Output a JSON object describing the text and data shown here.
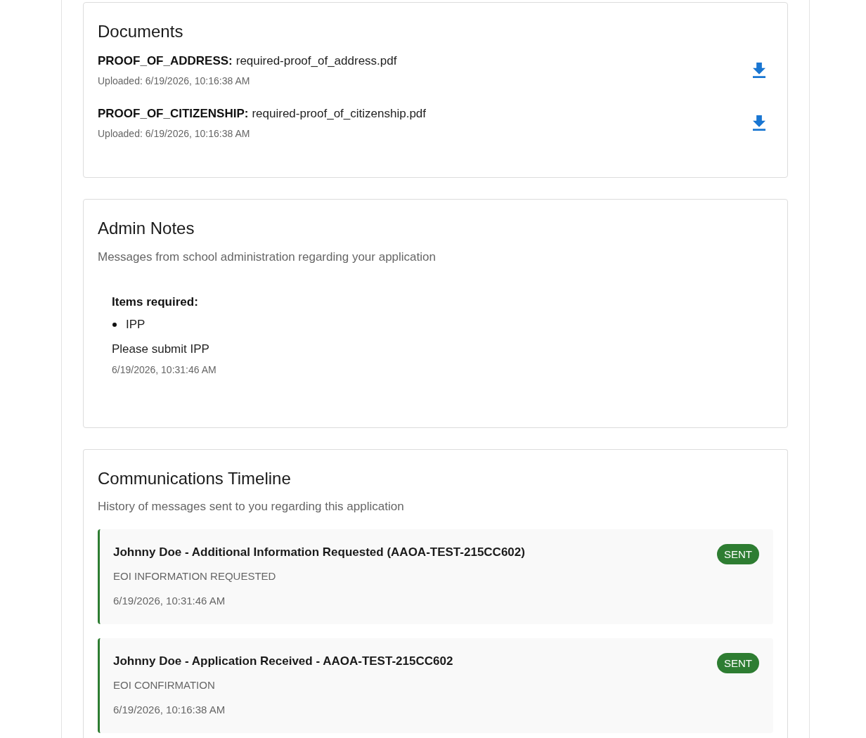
{
  "documents": {
    "title": "Documents",
    "files": [
      {
        "type": "PROOF_OF_ADDRESS:",
        "name": "required-proof_of_address.pdf",
        "uploaded": "Uploaded: 6/19/2026, 10:16:38 AM"
      },
      {
        "type": "PROOF_OF_CITIZENSHIP:",
        "name": "required-proof_of_citizenship.pdf",
        "uploaded": "Uploaded: 6/19/2026, 10:16:38 AM"
      }
    ]
  },
  "admin_notes": {
    "title": "Admin Notes",
    "subtitle": "Messages from school administration regarding your application",
    "notes": [
      {
        "heading": "Items required:",
        "items": [
          "IPP"
        ],
        "message": "Please submit IPP",
        "time": "6/19/2026, 10:31:46 AM"
      }
    ]
  },
  "communications_timeline": {
    "title": "Communications Timeline",
    "subtitle": "History of messages sent to you regarding this application",
    "entries": [
      {
        "subject": "Johnny Doe - Additional Information Requested (AAOA-TEST-215CC602)",
        "category": "EOI INFORMATION REQUESTED",
        "time": "6/19/2026, 10:31:46 AM",
        "status": "SENT"
      },
      {
        "subject": "Johnny Doe - Application Received - AAOA-TEST-215CC602",
        "category": "EOI CONFIRMATION",
        "time": "6/19/2026, 10:16:38 AM",
        "status": "SENT"
      }
    ]
  }
}
